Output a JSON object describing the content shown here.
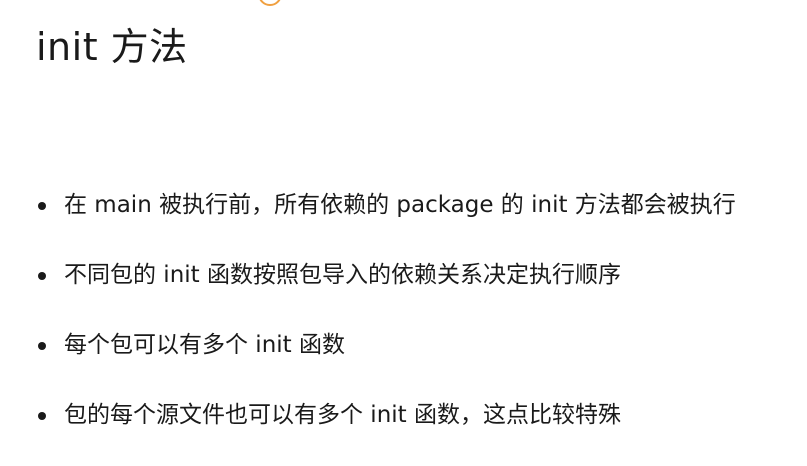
{
  "slide": {
    "title": "init 方法",
    "accent_color": "#f0a040",
    "bullets": [
      "在 main 被执行前，所有依赖的 package 的 init 方法都会被执行",
      "不同包的 init 函数按照包导入的依赖关系决定执行顺序",
      "每个包可以有多个 init 函数",
      "包的每个源文件也可以有多个 init 函数，这点比较特殊"
    ]
  }
}
